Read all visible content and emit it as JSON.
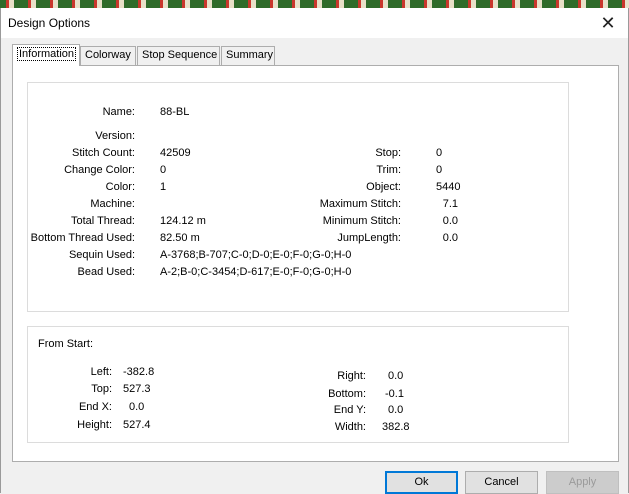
{
  "window": {
    "title": "Design Options",
    "close_glyph": "✕"
  },
  "tabs": [
    {
      "label": "Information",
      "active": true
    },
    {
      "label": "Colorway"
    },
    {
      "label": "Stop Sequence"
    },
    {
      "label": "Summary"
    }
  ],
  "info": {
    "name_label": "Name:",
    "name_value": "88-BL",
    "version_label": "Version:",
    "version_value": "",
    "stitch_count_label": "Stitch Count:",
    "stitch_count_value": "42509",
    "change_color_label": "Change Color:",
    "change_color_value": "0",
    "color_label": "Color:",
    "color_value": "1",
    "machine_label": "Machine:",
    "machine_value": "",
    "total_thread_label": "Total Thread:",
    "total_thread_value": "124.12 m",
    "bottom_thread_label": "Bottom Thread Used:",
    "bottom_thread_value": "82.50 m",
    "sequin_label": "Sequin Used:",
    "sequin_value": "A-3768;B-707;C-0;D-0;E-0;F-0;G-0;H-0",
    "bead_label": "Bead Used:",
    "bead_value": "A-2;B-0;C-3454;D-617;E-0;F-0;G-0;H-0",
    "stop_label": "Stop:",
    "stop_value": "0",
    "trim_label": "Trim:",
    "trim_value": "0",
    "object_label": "Object:",
    "object_value": "5440",
    "max_stitch_label": "Maximum Stitch:",
    "max_stitch_value": "7.1",
    "min_stitch_label": "Minimum Stitch:",
    "min_stitch_value": "0.0",
    "jump_length_label": "JumpLength:",
    "jump_length_value": "0.0"
  },
  "from_start": {
    "heading": "From Start:",
    "left_label": "Left:",
    "left_value": "-382.8",
    "top_label": "Top:",
    "top_value": "527.3",
    "endx_label": "End X:",
    "endx_value": "0.0",
    "height_label": "Height:",
    "height_value": "527.4",
    "right_label": "Right:",
    "right_value": "0.0",
    "bottom_label": "Bottom:",
    "bottom_value": "-0.1",
    "endy_label": "End Y:",
    "endy_value": "0.0",
    "width_label": "Width:",
    "width_value": "382.8"
  },
  "buttons": {
    "ok": "Ok",
    "cancel": "Cancel",
    "apply": "Apply"
  },
  "colors": {
    "accent": "#0078d7",
    "panel_border": "#adadad"
  }
}
